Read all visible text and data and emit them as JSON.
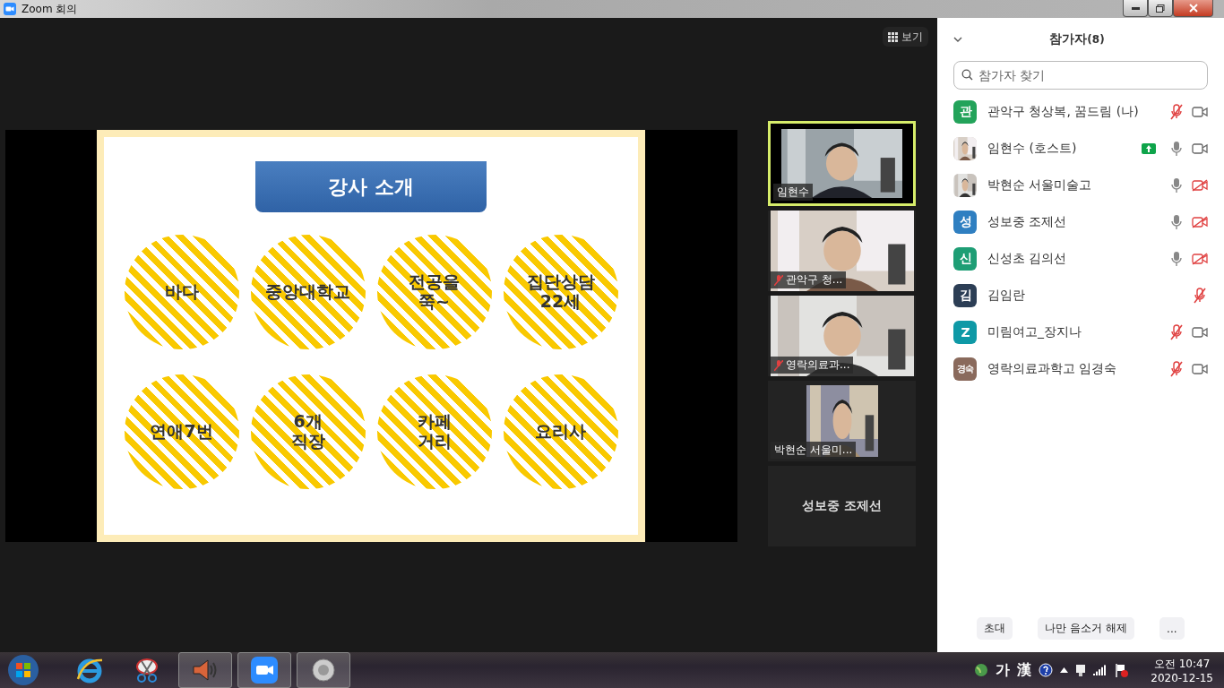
{
  "window": {
    "title": "Zoom 회의"
  },
  "view_button": {
    "label": "보기"
  },
  "slide": {
    "title": "강사 소개",
    "bubbles": [
      "바다",
      "중앙대학교",
      "전공을\n쭉~",
      "집단상담\n22세",
      "연애7번",
      "6개\n직장",
      "카페\n거리",
      "요리사"
    ]
  },
  "videos": [
    {
      "kind": "video",
      "name": "임현수",
      "active": true
    },
    {
      "kind": "video",
      "name": "관악구 청...",
      "muted": true,
      "active": false
    },
    {
      "kind": "video",
      "name": "영락의료과...",
      "muted": true,
      "active": false
    },
    {
      "name": "박현순 서울미...",
      "active": false
    },
    {
      "kind": "name_only",
      "name": "성보중 조제선",
      "active": false
    }
  ],
  "panel": {
    "title": "참가자",
    "count": "(8)",
    "search": {
      "placeholder": "참가자 찾기"
    },
    "participants": [
      {
        "name": "관악구 청상복, 꿈드림 (나)",
        "avatar": {
          "kind": "letter",
          "letter": "관",
          "color": "#23a35a"
        },
        "mic_muted": true,
        "video_off": false
      },
      {
        "name": "임현수 (호스트)",
        "sharing": true,
        "mic_muted": false,
        "video_off": false
      },
      {
        "name": "박현순 서울미술고",
        "mic_muted": false,
        "video_off": true
      },
      {
        "name": "성보중 조제선",
        "avatar": {
          "kind": "letter",
          "letter": "성",
          "color": "#2f7fc1"
        },
        "mic_muted": false,
        "video_off": true
      },
      {
        "name": "신성초 김의선",
        "avatar": {
          "kind": "letter",
          "letter": "신",
          "color": "#1e9e75"
        },
        "mic_muted": false,
        "video_off": true
      },
      {
        "name": "김임란",
        "avatar": {
          "kind": "letter",
          "letter": "김",
          "color": "#2c3e55"
        },
        "mic_muted": true
      },
      {
        "name": "미림여고_장지나",
        "avatar": {
          "kind": "letter",
          "letter": "Z",
          "color": "#0e99a6"
        },
        "mic_muted": true,
        "video_off": false
      },
      {
        "name": "영락의료과학고 임경숙",
        "avatar": {
          "kind": "letter",
          "letter": "경숙",
          "color": "#8a6a5c"
        },
        "mic_muted": true,
        "video_off": false
      }
    ],
    "buttons": [
      "초대",
      "나만 음소거 해제",
      "..."
    ]
  },
  "taskbar": {
    "ime": [
      "가",
      "漢"
    ],
    "time": "오전 10:47",
    "date": "2020-12-15"
  }
}
